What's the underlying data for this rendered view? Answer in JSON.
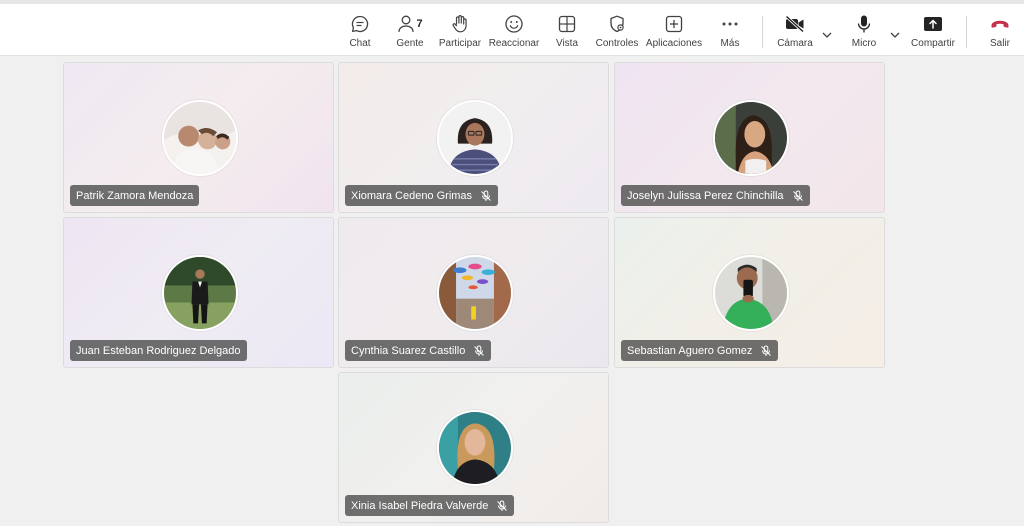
{
  "toolbar": {
    "chat": "Chat",
    "people": "Gente",
    "people_count": "7",
    "raise": "Participar",
    "react": "Reaccionar",
    "view": "Vista",
    "controls": "Controles",
    "apps": "Aplicaciones",
    "more": "Más",
    "camera": "Cámara",
    "mic": "Micro",
    "share": "Compartir",
    "leave": "Salir"
  },
  "colors": {
    "leave_red": "#c4314b",
    "tile_border": "#dcdcdc",
    "nametag_bg": "#505050"
  },
  "participants": [
    {
      "name": "Patrik Zamora Mendoza",
      "muted": false
    },
    {
      "name": "Xiomara Cedeno Grimas",
      "muted": true
    },
    {
      "name": "Joselyn Julissa Perez Chinchilla",
      "muted": true
    },
    {
      "name": "Juan Esteban Rodriguez Delgado",
      "muted": false
    },
    {
      "name": "Cynthia Suarez Castillo",
      "muted": true
    },
    {
      "name": "Sebastian Aguero Gomez",
      "muted": true
    },
    {
      "name": "Xinia Isabel Piedra Valverde",
      "muted": true
    }
  ]
}
